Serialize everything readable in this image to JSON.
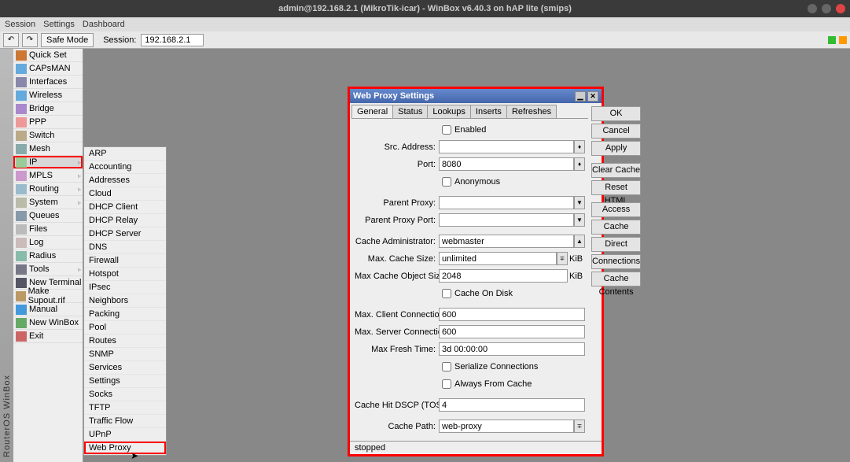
{
  "title": "admin@192.168.2.1 (MikroTik-icar) - WinBox v6.40.3 on hAP lite (smips)",
  "menubar": [
    "Session",
    "Settings",
    "Dashboard"
  ],
  "toolbar": {
    "undo": "↶",
    "redo": "↷",
    "safe_mode": "Safe Mode",
    "session_label": "Session:",
    "session_ip": "192.168.2.1"
  },
  "nav": [
    {
      "label": "Quick Set",
      "icon": "#c73"
    },
    {
      "label": "CAPsMAN",
      "icon": "#6ad"
    },
    {
      "label": "Interfaces",
      "icon": "#88a"
    },
    {
      "label": "Wireless",
      "icon": "#6ad"
    },
    {
      "label": "Bridge",
      "icon": "#a8c"
    },
    {
      "label": "PPP",
      "icon": "#e99"
    },
    {
      "label": "Switch",
      "icon": "#ba8"
    },
    {
      "label": "Mesh",
      "icon": "#8aa"
    },
    {
      "label": "IP",
      "icon": "#9c9",
      "sub": true,
      "sel": true,
      "hl": true
    },
    {
      "label": "MPLS",
      "icon": "#c9c",
      "sub": true
    },
    {
      "label": "Routing",
      "icon": "#9bc",
      "sub": true
    },
    {
      "label": "System",
      "icon": "#bba",
      "sub": true
    },
    {
      "label": "Queues",
      "icon": "#89a"
    },
    {
      "label": "Files",
      "icon": "#bbb"
    },
    {
      "label": "Log",
      "icon": "#cbb"
    },
    {
      "label": "Radius",
      "icon": "#8ba"
    },
    {
      "label": "Tools",
      "icon": "#778",
      "sub": true
    },
    {
      "label": "New Terminal",
      "icon": "#556"
    },
    {
      "label": "Make Supout.rif",
      "icon": "#b96"
    },
    {
      "label": "Manual",
      "icon": "#49d"
    },
    {
      "label": "New WinBox",
      "icon": "#6a6"
    },
    {
      "label": "Exit",
      "icon": "#c66"
    }
  ],
  "submenu": [
    "ARP",
    "Accounting",
    "Addresses",
    "Cloud",
    "DHCP Client",
    "DHCP Relay",
    "DHCP Server",
    "DNS",
    "Firewall",
    "Hotspot",
    "IPsec",
    "Neighbors",
    "Packing",
    "Pool",
    "Routes",
    "SNMP",
    "Services",
    "Settings",
    "Socks",
    "TFTP",
    "Traffic Flow",
    "UPnP",
    "Web Proxy"
  ],
  "submenu_highlight": "Web Proxy",
  "dialog": {
    "title": "Web Proxy Settings",
    "tabs": [
      "General",
      "Status",
      "Lookups",
      "Inserts",
      "Refreshes"
    ],
    "active_tab": "General",
    "fields": {
      "enabled": "Enabled",
      "src_address_lbl": "Src. Address:",
      "src_address": "",
      "port_lbl": "Port:",
      "port": "8080",
      "anonymous": "Anonymous",
      "parent_proxy_lbl": "Parent Proxy:",
      "parent_proxy": "",
      "parent_proxy_port_lbl": "Parent Proxy Port:",
      "parent_proxy_port": "",
      "cache_admin_lbl": "Cache Administrator:",
      "cache_admin": "webmaster",
      "max_cache_size_lbl": "Max. Cache Size:",
      "max_cache_size": "unlimited",
      "max_cache_size_unit": "KiB",
      "max_cache_obj_lbl": "Max Cache Object Size:",
      "max_cache_obj": "2048",
      "max_cache_obj_unit": "KiB",
      "cache_on_disk": "Cache On Disk",
      "max_client_conn_lbl": "Max. Client Connections:",
      "max_client_conn": "600",
      "max_server_conn_lbl": "Max. Server Connections:",
      "max_server_conn": "600",
      "max_fresh_time_lbl": "Max Fresh Time:",
      "max_fresh_time": "3d 00:00:00",
      "serialize_conn": "Serialize Connections",
      "always_from_cache": "Always From Cache",
      "cache_hit_dscp_lbl": "Cache Hit DSCP (TOS):",
      "cache_hit_dscp": "4",
      "cache_path_lbl": "Cache Path:",
      "cache_path": "web-proxy"
    },
    "buttons": [
      "OK",
      "Cancel",
      "Apply",
      "Clear Cache",
      "Reset HTML",
      "Access",
      "Cache",
      "Direct",
      "Connections",
      "Cache Contents"
    ],
    "status": "stopped"
  },
  "vsidebar": "RouterOS WinBox"
}
